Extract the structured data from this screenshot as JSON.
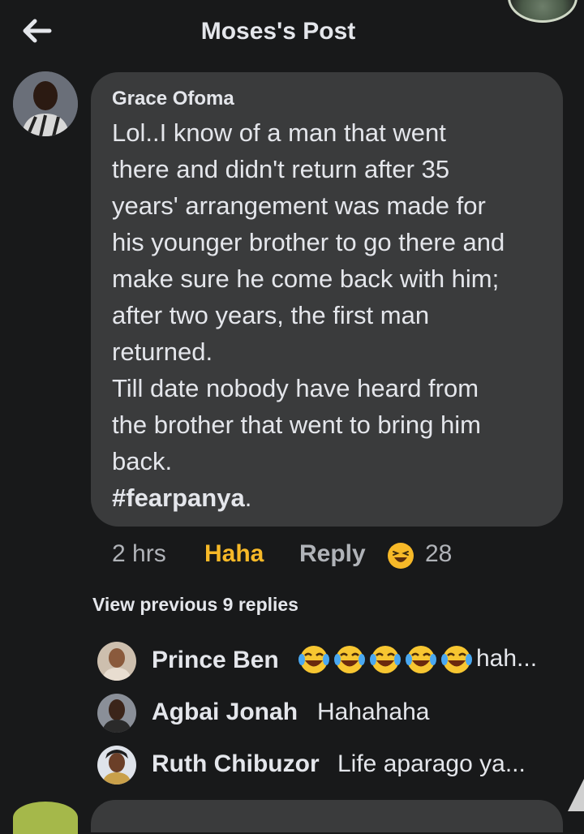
{
  "header": {
    "title": "Moses's Post",
    "back_icon": "arrow-left-icon"
  },
  "comment": {
    "author": "Grace Ofoma",
    "lines": [
      "Lol..I know of a man that went",
      "there and didn't return after 35",
      "years' arrangement was made for",
      "his younger brother to go there and",
      "make sure he come back with him;",
      "after two years, the first man",
      "returned.",
      "Till date nobody have heard from",
      "the brother that went to bring him",
      "back."
    ],
    "hashtag": "#fearpanya",
    "hashtag_suffix": ".",
    "time": "2 hrs",
    "reaction_label": "Haha",
    "reply_label": "Reply",
    "reaction_count": "28",
    "colors": {
      "haha": "#f7b928",
      "bubble": "#3a3b3c",
      "background": "#18191a"
    }
  },
  "view_previous": "View previous 9 replies",
  "replies": [
    {
      "name": "Prince Ben",
      "text": "hah...",
      "emoji_icon": "tears-of-joy-emoji-icon",
      "emoji_count": 5
    },
    {
      "name": "Agbai Jonah",
      "text": "Hahahaha"
    },
    {
      "name": "Ruth Chibuzor",
      "text": "Life aparago ya..."
    }
  ]
}
